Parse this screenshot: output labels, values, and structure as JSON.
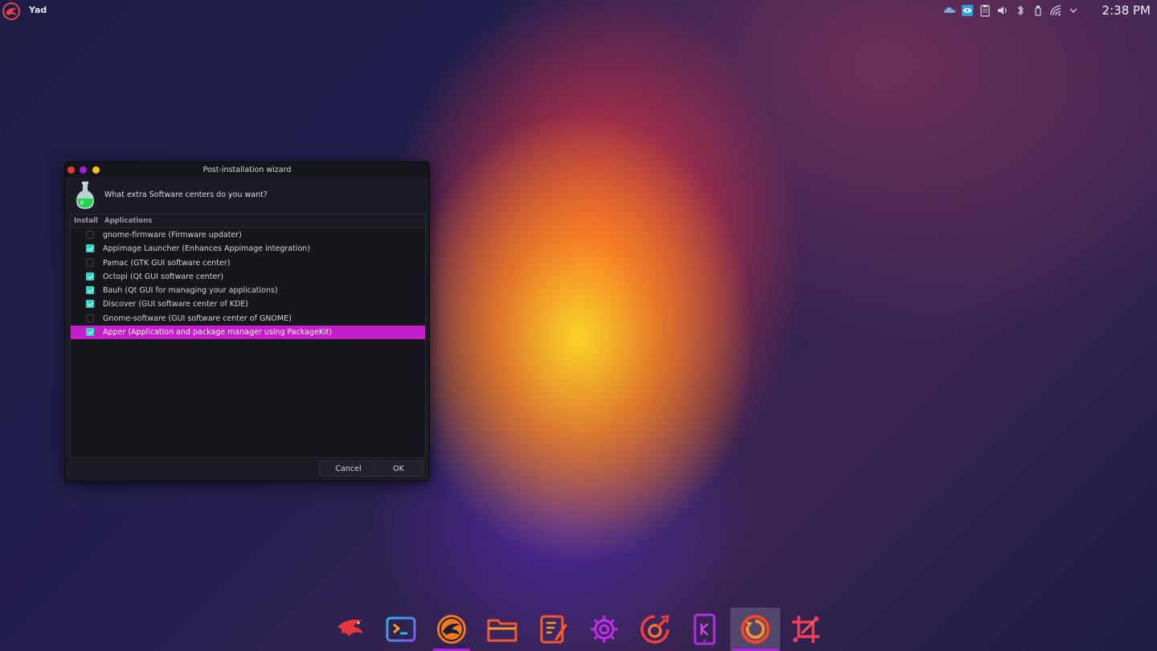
{
  "top_panel": {
    "app_name": "Yad",
    "clock": "2:38 PM",
    "tray_icons": [
      "cloud-icon",
      "eye-icon",
      "clipboard-icon",
      "volume-icon",
      "bluetooth-icon",
      "usb-icon",
      "wifi-icon",
      "chevron-down-icon"
    ]
  },
  "window": {
    "title": "Post-installation wizard",
    "question": "What extra Software centers do you want?",
    "columns": {
      "install": "Install",
      "applications": "Applications"
    },
    "rows": [
      {
        "label": "gnome-firmware (Firmware updater)",
        "checked": false
      },
      {
        "label": "Appimage Launcher (Enhances Appimage integration)",
        "checked": true
      },
      {
        "label": "Pamac (GTK GUI software center)",
        "checked": false
      },
      {
        "label": "Octopi (Qt GUI software center)",
        "checked": true
      },
      {
        "label": "Bauh (Qt GUI for managing your applications)",
        "checked": true
      },
      {
        "label": "Discover (GUI software center of KDE)",
        "checked": true
      },
      {
        "label": "Gnome-software (GUI software center of GNOME)",
        "checked": false
      },
      {
        "label": "Apper (Application and package manager using PackageKit)",
        "checked": true,
        "selected": true
      }
    ],
    "buttons": {
      "cancel": "Cancel",
      "ok": "OK"
    }
  },
  "colors": {
    "accent_selection": "#c41ec8",
    "checkbox_checked": "#2ed6c4",
    "close_button": "#e23a3a",
    "minimize_button": "#a21ce6",
    "maximize_button": "#f5c518",
    "dock_indicator": "#b01ee0"
  },
  "dock": [
    {
      "name": "eagle-app-icon",
      "active": false,
      "running": false
    },
    {
      "name": "terminal-icon",
      "active": false,
      "running": false
    },
    {
      "name": "garuda-welcome-icon",
      "active": false,
      "running": true
    },
    {
      "name": "file-manager-icon",
      "active": false,
      "running": false
    },
    {
      "name": "text-editor-icon",
      "active": false,
      "running": false
    },
    {
      "name": "settings-gear-icon",
      "active": false,
      "running": false
    },
    {
      "name": "assistant-icon",
      "active": false,
      "running": false
    },
    {
      "name": "kde-connect-icon",
      "active": false,
      "running": false
    },
    {
      "name": "setup-assistant-icon",
      "active": true,
      "running": true
    },
    {
      "name": "screenshot-crop-icon",
      "active": false,
      "running": false
    }
  ]
}
